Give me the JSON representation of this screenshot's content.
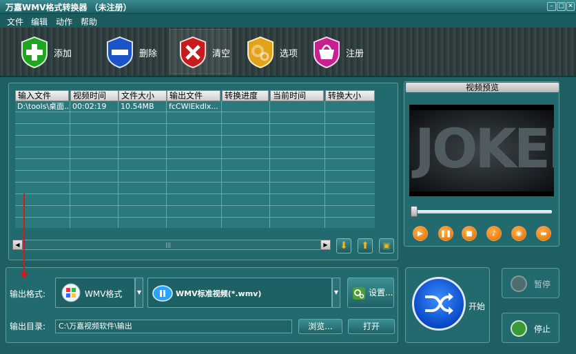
{
  "window": {
    "title": "万嘉WMV格式转换器 （未注册）",
    "controls": [
      "min-icon",
      "max-icon",
      "close-icon"
    ]
  },
  "menu": [
    "文件",
    "编辑",
    "动作",
    "帮助"
  ],
  "toolbar": {
    "add": "添加",
    "delete": "删除",
    "clear": "清空",
    "options": "选项",
    "register": "注册"
  },
  "table": {
    "headers": [
      "输入文件",
      "视频时间",
      "文件大小",
      "输出文件",
      "转换进度",
      "当前时间",
      "转换大小"
    ],
    "rows": [
      [
        "D:\\tools\\桌面...",
        "00:02:19",
        "10.54MB",
        "fcCWlEkdlx...",
        "",
        "",
        ""
      ]
    ]
  },
  "scrollbar": {
    "left_arrow": "◀",
    "right_arrow": "▶",
    "grip": "|||"
  },
  "preview": {
    "title": "视频预览",
    "video_text": "JOKER",
    "controls": [
      "play-icon",
      "pause-icon",
      "stop-icon",
      "volume-icon",
      "snapshot-icon",
      "folder-icon"
    ]
  },
  "output": {
    "format_label": "输出格式:",
    "format_value": "WMV格式",
    "preset_value": "WMV标准视频(*.wmv)",
    "settings_label": "设置...",
    "dir_label": "输出目录:",
    "dir_value": "C:\\万嘉视频软件\\输出",
    "browse_label": "浏览...",
    "open_label": "打开"
  },
  "actions": {
    "start_label": "开始",
    "pause_label": "暂停",
    "stop_label": "停止"
  },
  "colors": {
    "accent": "#1f5f62",
    "start_blue": "#0a48c8",
    "play_orange": "#e06b00"
  }
}
